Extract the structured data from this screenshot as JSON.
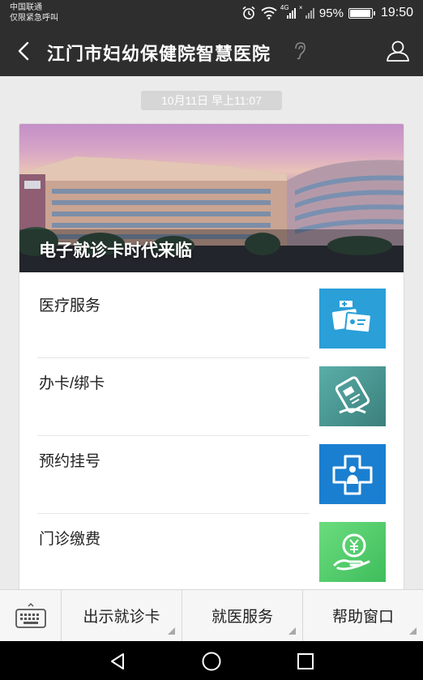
{
  "status_bar": {
    "carrier_line1": "中国联通",
    "carrier_line2": "仅限紧急呼叫",
    "network_label": "4G",
    "battery_percent": "95%",
    "battery_level": 0.95,
    "time": "19:50"
  },
  "header": {
    "title": "江门市妇幼保健院智慧医院",
    "back_icon": "back-chevron-icon",
    "ear_icon": "ear-icon",
    "profile_icon": "profile-icon"
  },
  "chat": {
    "timestamp": "10月11日 早上11:07"
  },
  "card": {
    "banner_caption": "电子就诊卡时代来临",
    "items": [
      {
        "label": "医疗服务",
        "icon": "medical-service-icon",
        "color": "#2a9fd8"
      },
      {
        "label": "办卡/绑卡",
        "icon": "card-binding-icon",
        "color": "#4a9a96"
      },
      {
        "label": "预约挂号",
        "icon": "appointment-icon",
        "color": "#1a7fd0"
      },
      {
        "label": "门诊缴费",
        "icon": "payment-icon",
        "color": "#4fcf6a"
      }
    ]
  },
  "bottom_menu": {
    "keyboard_icon": "keyboard-icon",
    "buttons": [
      {
        "label": "出示就诊卡"
      },
      {
        "label": "就医服务"
      },
      {
        "label": "帮助窗口"
      }
    ]
  },
  "nav": {
    "back": "nav-back-icon",
    "home": "nav-home-icon",
    "recent": "nav-recent-icon"
  }
}
